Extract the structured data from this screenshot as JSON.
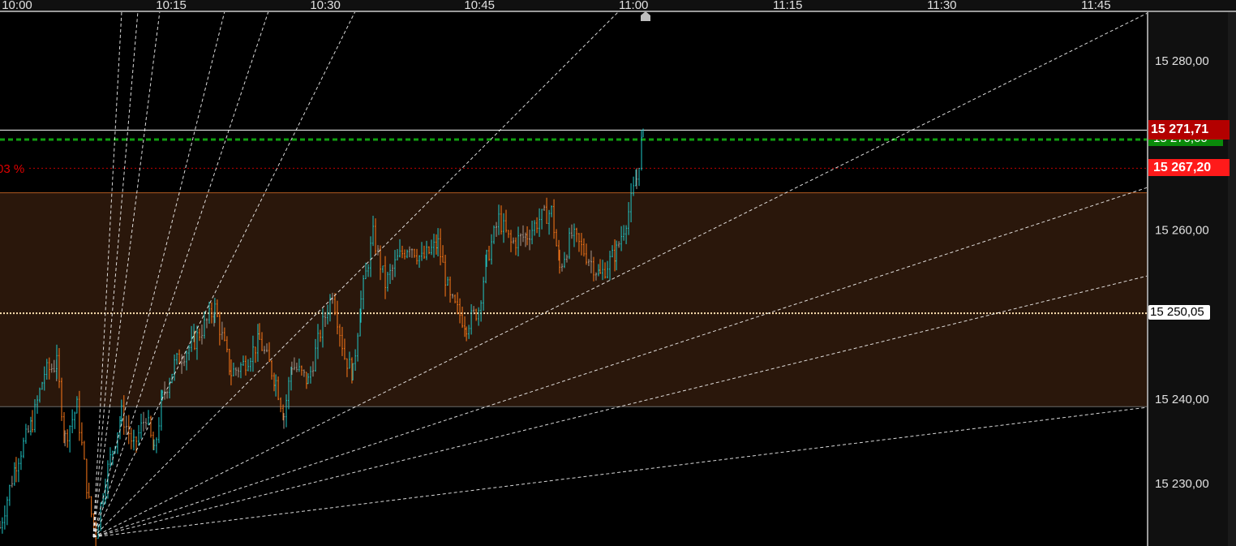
{
  "chart_data": {
    "type": "ohlc",
    "x_axis": {
      "ticks": [
        "10:00",
        "10:15",
        "10:30",
        "10:45",
        "11:00",
        "11:15",
        "11:30",
        "11:45"
      ],
      "range": [
        "09:58:20",
        "11:52:00"
      ]
    },
    "y_axis": {
      "ticks": [
        "15 280,00",
        "15 260,00",
        "15 240,00",
        "15 230,00"
      ],
      "tick_values": [
        15280,
        15260,
        15240,
        15230
      ],
      "range": [
        15223.0,
        15285.7
      ],
      "position": "right"
    },
    "grid": false,
    "price_path": [
      [
        "09:58:20",
        15224.7
      ],
      [
        "09:59:55",
        15232.4
      ],
      [
        "10:01:30",
        15237.2
      ],
      [
        "10:02:40",
        15243.0
      ],
      [
        "10:03:52",
        15244.0
      ],
      [
        "10:04:40",
        15235.3
      ],
      [
        "10:05:50",
        15239.0
      ],
      [
        "10:07:00",
        15227.6
      ],
      [
        "10:07:40",
        15224.0
      ],
      [
        "10:08:36",
        15230.5
      ],
      [
        "10:10:10",
        15238.2
      ],
      [
        "10:11:22",
        15234.3
      ],
      [
        "10:12:33",
        15238.0
      ],
      [
        "10:13:20",
        15233.4
      ],
      [
        "10:14:08",
        15240.0
      ],
      [
        "10:15:19",
        15244.0
      ],
      [
        "10:17:17",
        15246.8
      ],
      [
        "10:19:15",
        15250.6
      ],
      [
        "10:20:50",
        15243.0
      ],
      [
        "10:22:01",
        15244.0
      ],
      [
        "10:23:36",
        15246.8
      ],
      [
        "10:25:11",
        15242.0
      ],
      [
        "10:25:58",
        15238.0
      ],
      [
        "10:26:45",
        15244.0
      ],
      [
        "10:28:20",
        15242.0
      ],
      [
        "10:29:31",
        15247.8
      ],
      [
        "10:30:42",
        15252.6
      ],
      [
        "10:31:53",
        15244.9
      ],
      [
        "10:32:41",
        15243.0
      ],
      [
        "10:33:28",
        15251.6
      ],
      [
        "10:34:39",
        15259.3
      ],
      [
        "10:35:50",
        15253.5
      ],
      [
        "10:37:01",
        15256.4
      ],
      [
        "10:38:12",
        15258.3
      ],
      [
        "10:39:23",
        15256.4
      ],
      [
        "10:40:58",
        15258.3
      ],
      [
        "10:42:09",
        15251.6
      ],
      [
        "10:43:44",
        15248.7
      ],
      [
        "10:44:55",
        15250.6
      ],
      [
        "10:45:42",
        15256.4
      ],
      [
        "10:46:53",
        15261.2
      ],
      [
        "10:48:04",
        15258.3
      ],
      [
        "10:49:39",
        15259.3
      ],
      [
        "10:50:50",
        15261.2
      ],
      [
        "10:52:01",
        15262.1
      ],
      [
        "10:52:48",
        15255.4
      ],
      [
        "10:53:59",
        15259.3
      ],
      [
        "10:55:10",
        15257.4
      ],
      [
        "10:56:45",
        15254.5
      ],
      [
        "10:58:20",
        15257.4
      ],
      [
        "10:59:31",
        15262.1
      ],
      [
        "11:00:18",
        15266.0
      ],
      [
        "11:00:56",
        15271.7
      ]
    ],
    "levels": {
      "last": {
        "value": 15271.71,
        "label": "15 271,71",
        "color": "#b30000"
      },
      "green_dashed": {
        "value": 15270.6,
        "label": "15 270,60",
        "color": "#0a8a0a"
      },
      "red_dotted": {
        "value": 15267.2,
        "label": "15 267,20",
        "color": "#ff1a1a",
        "left_label": "03 %"
      },
      "mid_dotted": {
        "value": 15250.05,
        "label": "15 250,05",
        "color": "#ffe0b0"
      },
      "band": {
        "from": 15239.0,
        "to": 15264.3,
        "color": "#2a170b",
        "edge": "#b05a20"
      }
    },
    "colors": {
      "up": "#21c8c8",
      "down": "#ff7a1a",
      "neutral": "#a89a90",
      "fan": "#ffffff"
    },
    "marker": {
      "time": "11:00",
      "icon": "house-marker-icon"
    }
  }
}
